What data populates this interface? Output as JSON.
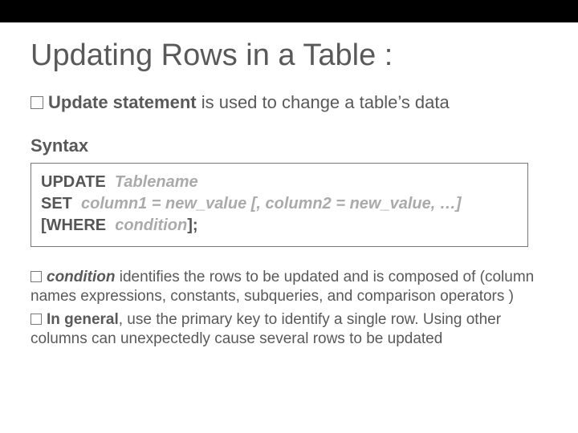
{
  "title": "Updating Rows in a Table :",
  "intro": {
    "bold": "Update statement",
    "rest": "  is used to change a table’s data"
  },
  "syntax_label": "Syntax",
  "syntax": {
    "l1_kw": "UPDATE  ",
    "l1_it": "Tablename",
    "l2_kw": "SET  ",
    "l2_it": "column1 = new_value [, column2 = new_value, …]",
    "l3_kw1": "[WHERE  ",
    "l3_it": "condition",
    "l3_kw2": "];"
  },
  "bullets": [
    {
      "bi": "condition ",
      "text": "identifies the rows to be updated and is composed of (column names expressions, constants, subqueries, and comparison operators )"
    },
    {
      "b": "In general",
      "text": ", use the primary key to identify a single row. Using other columns can unexpectedly cause several rows to be updated"
    }
  ]
}
